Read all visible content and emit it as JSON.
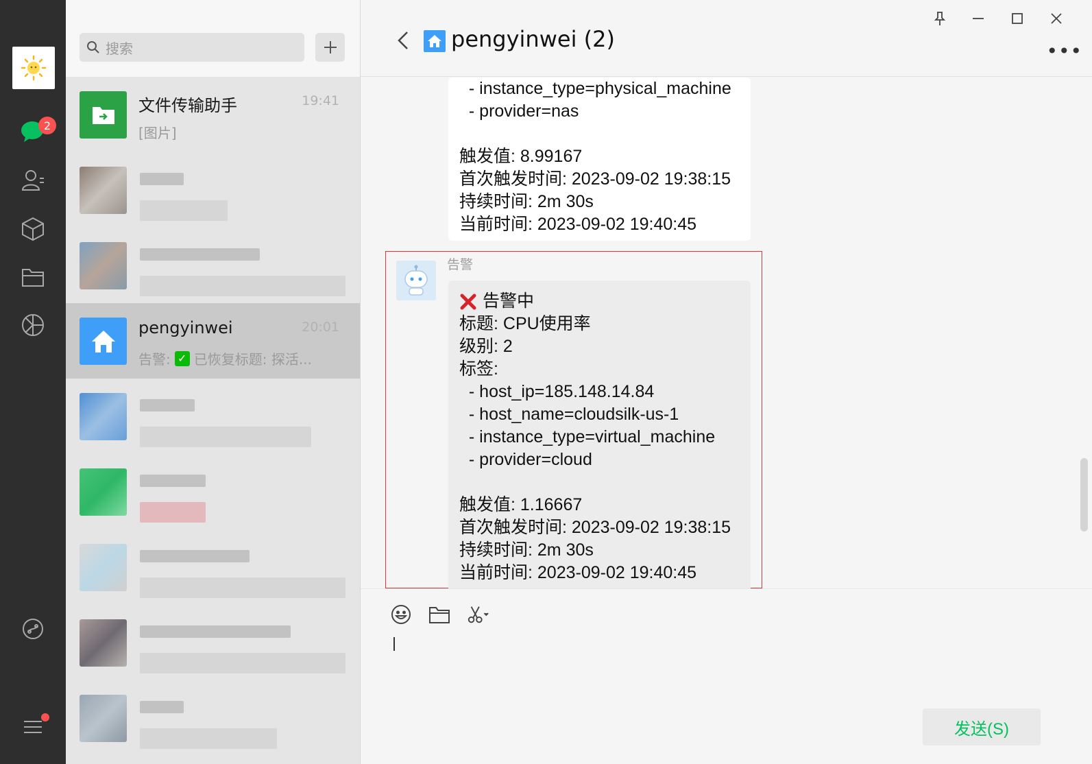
{
  "rail": {
    "unread_badge": "2",
    "icons": [
      "chats-icon",
      "contacts-icon",
      "favorites-icon",
      "files-icon",
      "moments-icon",
      "miniprogram-icon",
      "menu-icon"
    ]
  },
  "search": {
    "placeholder": "搜索"
  },
  "chats": [
    {
      "name": "文件传输助手",
      "time": "19:41",
      "preview": "[图片]"
    },
    {
      "name": "pengyinwei",
      "time": "20:01",
      "preview_prefix": "告警:",
      "preview_text": "已恢复标题: 探活..."
    }
  ],
  "header": {
    "title": "pengyinwei (2)"
  },
  "messages": {
    "first_bubble": [
      "  - instance_type=physical_machine",
      "  - provider=nas",
      "",
      "触发值: 8.99167",
      "首次触发时间: 2023-09-02 19:38:15",
      "持续时间: 2m 30s",
      "当前时间: 2023-09-02 19:40:45"
    ],
    "second_sender": "告警",
    "second_bubble": {
      "status": "告警中",
      "lines": [
        "标题: CPU使用率",
        "级别: 2",
        "标签:",
        "  - host_ip=185.148.14.84",
        "  - host_name=cloudsilk-us-1",
        "  - instance_type=virtual_machine",
        "  - provider=cloud",
        "",
        "触发值: 1.16667",
        "首次触发时间: 2023-09-02 19:38:15",
        "持续时间: 2m 30s",
        "当前时间: 2023-09-02 19:40:45"
      ]
    }
  },
  "composer": {
    "send_label": "发送(S)"
  },
  "colors": {
    "accent_green": "#07c160",
    "badge_red": "#fa5151",
    "highlight_red": "#e0343a",
    "home_blue": "#3f9ef7"
  }
}
